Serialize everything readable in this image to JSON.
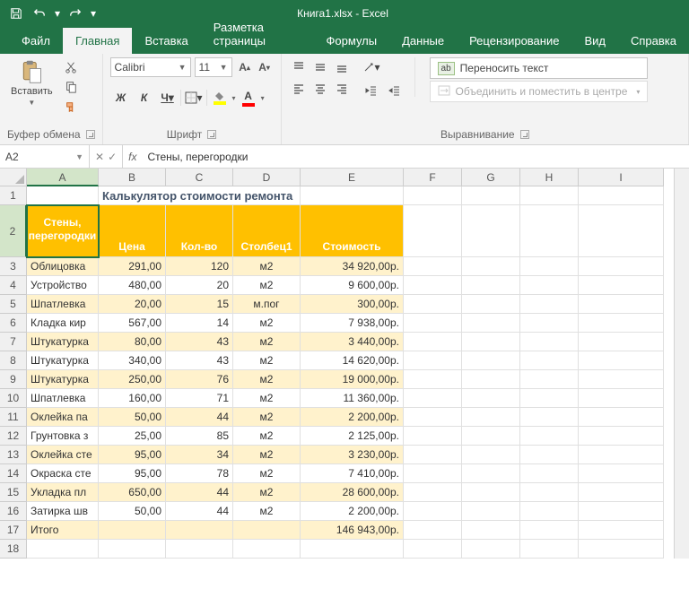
{
  "title": "Книга1.xlsx  -  Excel",
  "tabs": {
    "file": "Файл",
    "home": "Главная",
    "insert": "Вставка",
    "layout": "Разметка страницы",
    "formulas": "Формулы",
    "data": "Данные",
    "review": "Рецензирование",
    "view": "Вид",
    "help": "Справка"
  },
  "ribbon": {
    "clipboard": {
      "paste": "Вставить",
      "label": "Буфер обмена"
    },
    "font": {
      "name": "Calibri",
      "size": "11",
      "bold": "Ж",
      "italic": "К",
      "underline": "Ч",
      "incA": "А",
      "decA": "А",
      "label": "Шрифт"
    },
    "align": {
      "wrap": "Переносить текст",
      "merge": "Объединить и поместить в центре",
      "label": "Выравнивание"
    }
  },
  "namebox": "A2",
  "formula": "Стены, перегородки",
  "cols": [
    "A",
    "B",
    "C",
    "D",
    "E",
    "F",
    "G",
    "H",
    "I"
  ],
  "titleCell": "Калькулятор стоимости ремонта",
  "headers": {
    "A": "Стены, перегородки",
    "B": "Цена",
    "C": "Кол-во",
    "D": "Столбец1",
    "E": "Стоимость"
  },
  "rows": [
    {
      "n": "3",
      "A": "Облицовка",
      "B": "291,00",
      "C": "120",
      "D": "м2",
      "E": "34 920,00р."
    },
    {
      "n": "4",
      "A": "Устройство",
      "B": "480,00",
      "C": "20",
      "D": "м2",
      "E": "9 600,00р."
    },
    {
      "n": "5",
      "A": "Шпатлевка",
      "B": "20,00",
      "C": "15",
      "D": "м.пог",
      "E": "300,00р."
    },
    {
      "n": "6",
      "A": "Кладка кир",
      "B": "567,00",
      "C": "14",
      "D": "м2",
      "E": "7 938,00р."
    },
    {
      "n": "7",
      "A": "Штукатурка",
      "B": "80,00",
      "C": "43",
      "D": "м2",
      "E": "3 440,00р."
    },
    {
      "n": "8",
      "A": "Штукатурка",
      "B": "340,00",
      "C": "43",
      "D": "м2",
      "E": "14 620,00р."
    },
    {
      "n": "9",
      "A": "Штукатурка",
      "B": "250,00",
      "C": "76",
      "D": "м2",
      "E": "19 000,00р."
    },
    {
      "n": "10",
      "A": "Шпатлевка",
      "B": "160,00",
      "C": "71",
      "D": "м2",
      "E": "11 360,00р."
    },
    {
      "n": "11",
      "A": "Оклейка па",
      "B": "50,00",
      "C": "44",
      "D": "м2",
      "E": "2 200,00р."
    },
    {
      "n": "12",
      "A": "Грунтовка з",
      "B": "25,00",
      "C": "85",
      "D": "м2",
      "E": "2 125,00р."
    },
    {
      "n": "13",
      "A": "Оклейка сте",
      "B": "95,00",
      "C": "34",
      "D": "м2",
      "E": "3 230,00р."
    },
    {
      "n": "14",
      "A": "Окраска сте",
      "B": "95,00",
      "C": "78",
      "D": "м2",
      "E": "7 410,00р."
    },
    {
      "n": "15",
      "A": "Укладка пл",
      "B": "650,00",
      "C": "44",
      "D": "м2",
      "E": "28 600,00р."
    },
    {
      "n": "16",
      "A": "Затирка шв",
      "B": "50,00",
      "C": "44",
      "D": "м2",
      "E": "2 200,00р."
    },
    {
      "n": "17",
      "A": "Итого",
      "B": "",
      "C": "",
      "D": "",
      "E": "146 943,00р."
    }
  ]
}
